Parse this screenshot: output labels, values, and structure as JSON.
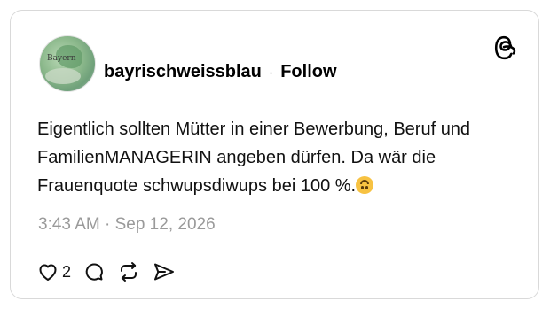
{
  "post": {
    "username": "bayrischweissblau",
    "separator": "·",
    "follow_label": "Follow",
    "avatar_text": "Bayern",
    "text": "Eigentlich sollten Mütter in einer Bewerbung, Beruf und FamilienMANAGERIN angeben dürfen. Da wär die Frauenquote schwupsdiwups bei 100 %.",
    "emoji": "upside-down-face",
    "timestamp": "3:43 AM · Sep 12, 2026",
    "likes": "2"
  },
  "icons": {
    "logo": "threads-logo-icon",
    "like": "heart-icon",
    "comment": "comment-icon",
    "repost": "repost-icon",
    "share": "share-icon"
  },
  "colors": {
    "text": "#111111",
    "muted": "#9a9a9a",
    "border": "#d9d9d9"
  }
}
